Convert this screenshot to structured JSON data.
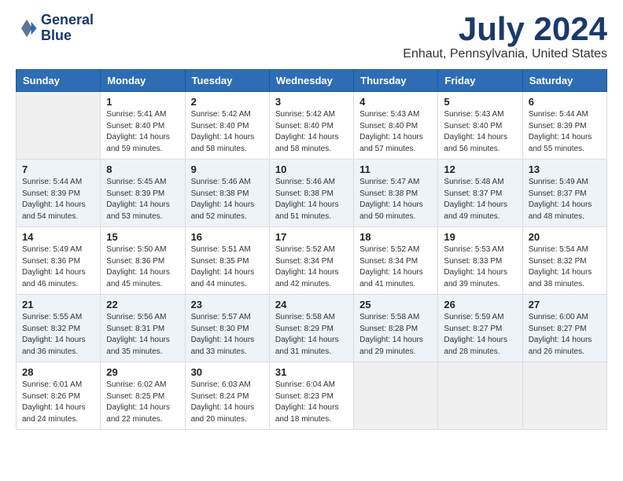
{
  "logo": {
    "line1": "General",
    "line2": "Blue"
  },
  "title": "July 2024",
  "location": "Enhaut, Pennsylvania, United States",
  "days_of_week": [
    "Sunday",
    "Monday",
    "Tuesday",
    "Wednesday",
    "Thursday",
    "Friday",
    "Saturday"
  ],
  "weeks": [
    [
      {
        "day": "",
        "info": ""
      },
      {
        "day": "1",
        "info": "Sunrise: 5:41 AM\nSunset: 8:40 PM\nDaylight: 14 hours\nand 59 minutes."
      },
      {
        "day": "2",
        "info": "Sunrise: 5:42 AM\nSunset: 8:40 PM\nDaylight: 14 hours\nand 58 minutes."
      },
      {
        "day": "3",
        "info": "Sunrise: 5:42 AM\nSunset: 8:40 PM\nDaylight: 14 hours\nand 58 minutes."
      },
      {
        "day": "4",
        "info": "Sunrise: 5:43 AM\nSunset: 8:40 PM\nDaylight: 14 hours\nand 57 minutes."
      },
      {
        "day": "5",
        "info": "Sunrise: 5:43 AM\nSunset: 8:40 PM\nDaylight: 14 hours\nand 56 minutes."
      },
      {
        "day": "6",
        "info": "Sunrise: 5:44 AM\nSunset: 8:39 PM\nDaylight: 14 hours\nand 55 minutes."
      }
    ],
    [
      {
        "day": "7",
        "info": "Sunrise: 5:44 AM\nSunset: 8:39 PM\nDaylight: 14 hours\nand 54 minutes."
      },
      {
        "day": "8",
        "info": "Sunrise: 5:45 AM\nSunset: 8:39 PM\nDaylight: 14 hours\nand 53 minutes."
      },
      {
        "day": "9",
        "info": "Sunrise: 5:46 AM\nSunset: 8:38 PM\nDaylight: 14 hours\nand 52 minutes."
      },
      {
        "day": "10",
        "info": "Sunrise: 5:46 AM\nSunset: 8:38 PM\nDaylight: 14 hours\nand 51 minutes."
      },
      {
        "day": "11",
        "info": "Sunrise: 5:47 AM\nSunset: 8:38 PM\nDaylight: 14 hours\nand 50 minutes."
      },
      {
        "day": "12",
        "info": "Sunrise: 5:48 AM\nSunset: 8:37 PM\nDaylight: 14 hours\nand 49 minutes."
      },
      {
        "day": "13",
        "info": "Sunrise: 5:49 AM\nSunset: 8:37 PM\nDaylight: 14 hours\nand 48 minutes."
      }
    ],
    [
      {
        "day": "14",
        "info": "Sunrise: 5:49 AM\nSunset: 8:36 PM\nDaylight: 14 hours\nand 46 minutes."
      },
      {
        "day": "15",
        "info": "Sunrise: 5:50 AM\nSunset: 8:36 PM\nDaylight: 14 hours\nand 45 minutes."
      },
      {
        "day": "16",
        "info": "Sunrise: 5:51 AM\nSunset: 8:35 PM\nDaylight: 14 hours\nand 44 minutes."
      },
      {
        "day": "17",
        "info": "Sunrise: 5:52 AM\nSunset: 8:34 PM\nDaylight: 14 hours\nand 42 minutes."
      },
      {
        "day": "18",
        "info": "Sunrise: 5:52 AM\nSunset: 8:34 PM\nDaylight: 14 hours\nand 41 minutes."
      },
      {
        "day": "19",
        "info": "Sunrise: 5:53 AM\nSunset: 8:33 PM\nDaylight: 14 hours\nand 39 minutes."
      },
      {
        "day": "20",
        "info": "Sunrise: 5:54 AM\nSunset: 8:32 PM\nDaylight: 14 hours\nand 38 minutes."
      }
    ],
    [
      {
        "day": "21",
        "info": "Sunrise: 5:55 AM\nSunset: 8:32 PM\nDaylight: 14 hours\nand 36 minutes."
      },
      {
        "day": "22",
        "info": "Sunrise: 5:56 AM\nSunset: 8:31 PM\nDaylight: 14 hours\nand 35 minutes."
      },
      {
        "day": "23",
        "info": "Sunrise: 5:57 AM\nSunset: 8:30 PM\nDaylight: 14 hours\nand 33 minutes."
      },
      {
        "day": "24",
        "info": "Sunrise: 5:58 AM\nSunset: 8:29 PM\nDaylight: 14 hours\nand 31 minutes."
      },
      {
        "day": "25",
        "info": "Sunrise: 5:58 AM\nSunset: 8:28 PM\nDaylight: 14 hours\nand 29 minutes."
      },
      {
        "day": "26",
        "info": "Sunrise: 5:59 AM\nSunset: 8:27 PM\nDaylight: 14 hours\nand 28 minutes."
      },
      {
        "day": "27",
        "info": "Sunrise: 6:00 AM\nSunset: 8:27 PM\nDaylight: 14 hours\nand 26 minutes."
      }
    ],
    [
      {
        "day": "28",
        "info": "Sunrise: 6:01 AM\nSunset: 8:26 PM\nDaylight: 14 hours\nand 24 minutes."
      },
      {
        "day": "29",
        "info": "Sunrise: 6:02 AM\nSunset: 8:25 PM\nDaylight: 14 hours\nand 22 minutes."
      },
      {
        "day": "30",
        "info": "Sunrise: 6:03 AM\nSunset: 8:24 PM\nDaylight: 14 hours\nand 20 minutes."
      },
      {
        "day": "31",
        "info": "Sunrise: 6:04 AM\nSunset: 8:23 PM\nDaylight: 14 hours\nand 18 minutes."
      },
      {
        "day": "",
        "info": ""
      },
      {
        "day": "",
        "info": ""
      },
      {
        "day": "",
        "info": ""
      }
    ]
  ]
}
